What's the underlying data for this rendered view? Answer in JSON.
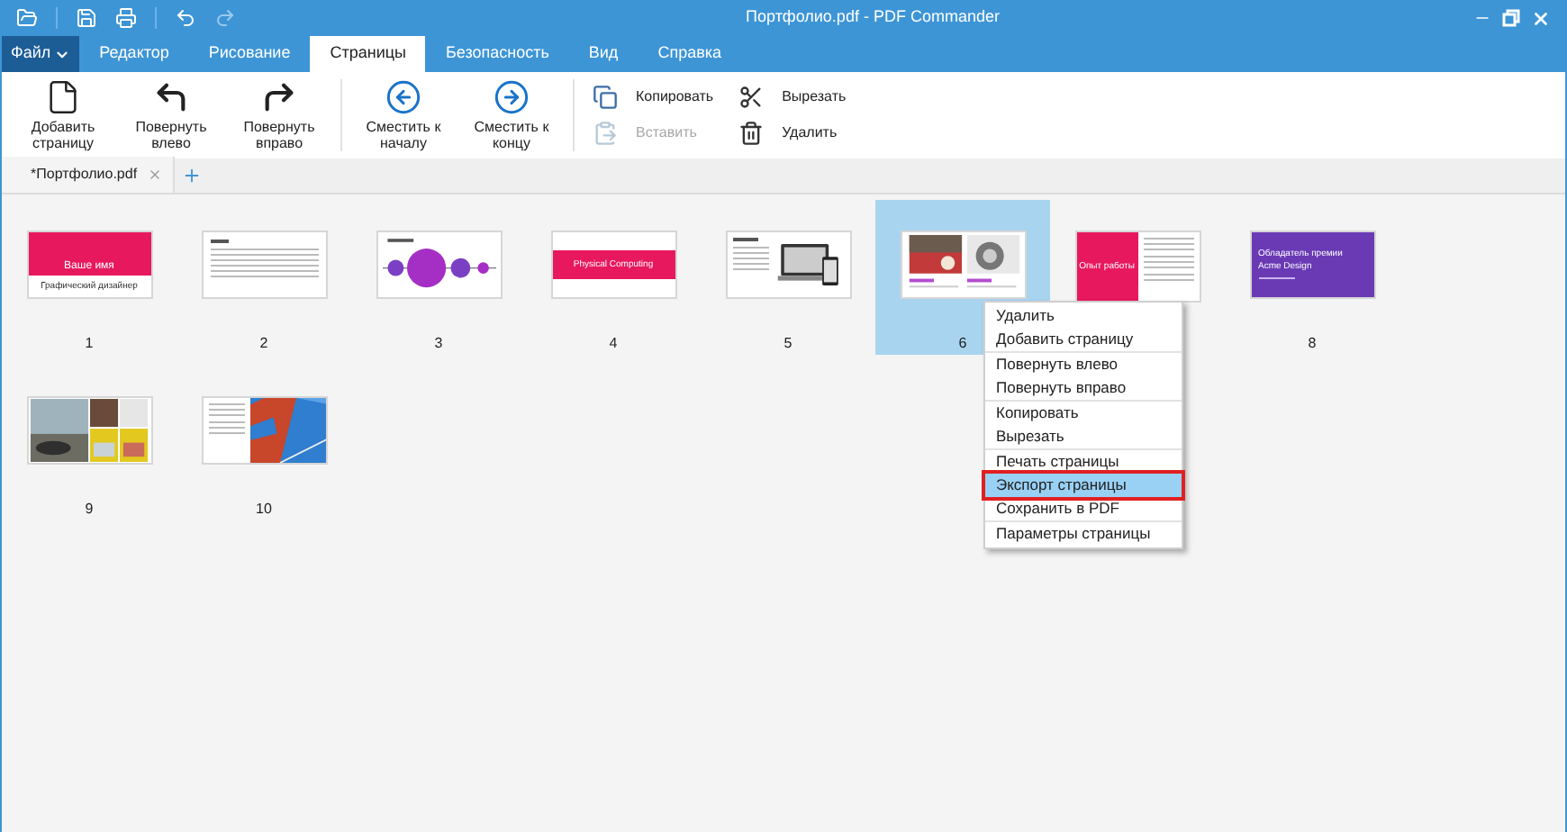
{
  "window": {
    "title": "Портфолио.pdf - PDF Commander"
  },
  "menu_tabs": [
    {
      "label": "Файл",
      "kind": "file",
      "selected": false
    },
    {
      "label": "Редактор",
      "kind": "tab",
      "selected": false
    },
    {
      "label": "Рисование",
      "kind": "tab",
      "selected": false
    },
    {
      "label": "Страницы",
      "kind": "tab",
      "selected": true
    },
    {
      "label": "Безопасность",
      "kind": "tab",
      "selected": false
    },
    {
      "label": "Вид",
      "kind": "tab",
      "selected": false
    },
    {
      "label": "Справка",
      "kind": "tab",
      "selected": false
    }
  ],
  "ribbon": {
    "groups": [
      [
        {
          "label": "Добавить страницу"
        },
        {
          "label": "Повернуть влево"
        },
        {
          "label": "Повернуть вправо"
        }
      ],
      [
        {
          "label": "Сместить к началу"
        },
        {
          "label": "Сместить к концу"
        }
      ]
    ],
    "small_buttons": [
      {
        "label": "Копировать",
        "disabled": false
      },
      {
        "label": "Вставить",
        "disabled": true
      },
      {
        "label": "Вырезать",
        "disabled": false
      },
      {
        "label": "Удалить",
        "disabled": false
      }
    ]
  },
  "document_tabs": [
    {
      "label": "*Портфолио.pdf",
      "selected": true
    }
  ],
  "pages": [
    {
      "number": "1",
      "kind": "cover",
      "selected": false,
      "texts": [
        "Ваше имя",
        "Графический дизайнер"
      ]
    },
    {
      "number": "2",
      "kind": "text",
      "selected": false
    },
    {
      "number": "3",
      "kind": "circles",
      "selected": false
    },
    {
      "number": "4",
      "kind": "banner",
      "selected": false,
      "texts": [
        "Physical Computing"
      ]
    },
    {
      "number": "5",
      "kind": "devices",
      "selected": false
    },
    {
      "number": "6",
      "kind": "photos",
      "selected": true
    },
    {
      "kind": "split",
      "selected": false,
      "texts": [
        "Опыт работы"
      ]
    },
    {
      "number": "8",
      "kind": "award",
      "selected": false,
      "texts": [
        "Обладатель премии",
        "Acme Design"
      ]
    },
    {
      "number": "9",
      "kind": "collage",
      "selected": false
    },
    {
      "number": "10",
      "kind": "photo-split",
      "selected": false
    }
  ],
  "context_menu": {
    "groups": [
      [
        {
          "label": "Удалить",
          "selected": false
        },
        {
          "label": "Добавить страницу",
          "selected": false
        }
      ],
      [
        {
          "label": "Повернуть влево",
          "selected": false
        },
        {
          "label": "Повернуть вправо",
          "selected": false
        }
      ],
      [
        {
          "label": "Копировать",
          "selected": false
        },
        {
          "label": "Вырезать",
          "selected": false
        }
      ],
      [
        {
          "label": "Печать страницы",
          "selected": false
        },
        {
          "label": "Экспорт страницы",
          "selected": true
        },
        {
          "label": "Сохранить в PDF",
          "selected": false
        }
      ],
      [
        {
          "label": "Параметры страницы",
          "selected": false
        }
      ]
    ]
  }
}
